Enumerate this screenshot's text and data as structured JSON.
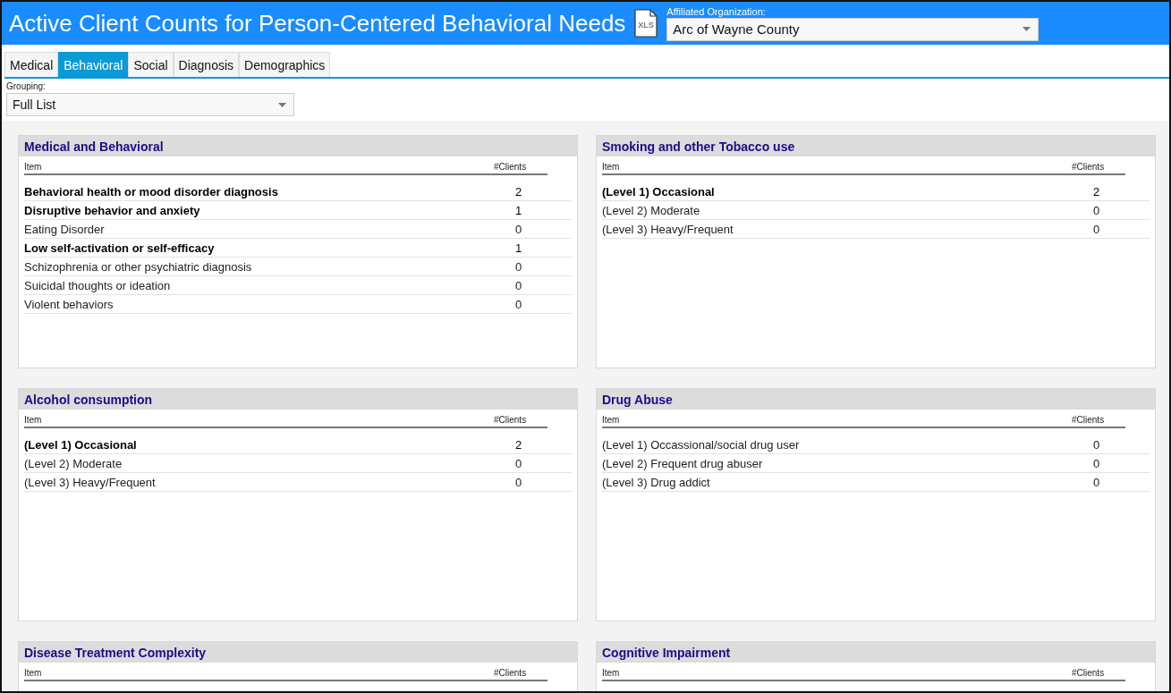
{
  "header": {
    "title": "Active Client Counts for Person-Centered Behavioral Needs",
    "export_icon_text": "XLS",
    "organization": {
      "label": "Affiliated Organization:",
      "value": "Arc of Wayne County"
    }
  },
  "tabs": [
    {
      "label": "Medical",
      "selected": false
    },
    {
      "label": "Behavioral",
      "selected": true
    },
    {
      "label": "Social",
      "selected": false
    },
    {
      "label": "Diagnosis",
      "selected": false
    },
    {
      "label": "Demographics",
      "selected": false
    }
  ],
  "grouping": {
    "label": "Grouping:",
    "value": "Full List"
  },
  "panels": [
    {
      "title": "Medical and Behavioral",
      "columns": [
        "Item",
        "#Clients"
      ],
      "rows": [
        {
          "item": "Behavioral health or mood disorder diagnosis",
          "clients": "2",
          "emphasized": true
        },
        {
          "item": "Disruptive behavior and anxiety",
          "clients": "1",
          "emphasized": true
        },
        {
          "item": "Eating Disorder",
          "clients": "0",
          "emphasized": false
        },
        {
          "item": "Low self-activation or self-efficacy",
          "clients": "1",
          "emphasized": true
        },
        {
          "item": "Schizophrenia or other psychiatric diagnosis",
          "clients": "0",
          "emphasized": false
        },
        {
          "item": "Suicidal thoughts or ideation",
          "clients": "0",
          "emphasized": false
        },
        {
          "item": "Violent behaviors",
          "clients": "0",
          "emphasized": false
        }
      ]
    },
    {
      "title": "Smoking and other Tobacco use",
      "columns": [
        "Item",
        "#Clients"
      ],
      "rows": [
        {
          "item": "(Level 1) Occasional",
          "clients": "2",
          "emphasized": true
        },
        {
          "item": "(Level 2) Moderate",
          "clients": "0",
          "emphasized": false
        },
        {
          "item": "(Level 3) Heavy/Frequent",
          "clients": "0",
          "emphasized": false
        }
      ]
    },
    {
      "title": "Alcohol consumption",
      "columns": [
        "Item",
        "#Clients"
      ],
      "rows": [
        {
          "item": "(Level 1) Occasional",
          "clients": "2",
          "emphasized": true
        },
        {
          "item": "(Level 2) Moderate",
          "clients": "0",
          "emphasized": false
        },
        {
          "item": "(Level 3) Heavy/Frequent",
          "clients": "0",
          "emphasized": false
        }
      ]
    },
    {
      "title": "Drug Abuse",
      "columns": [
        "Item",
        "#Clients"
      ],
      "rows": [
        {
          "item": "(Level 1) Occassional/social drug user",
          "clients": "0",
          "emphasized": false
        },
        {
          "item": "(Level 2) Frequent drug abuser",
          "clients": "0",
          "emphasized": false
        },
        {
          "item": "(Level 3) Drug addict",
          "clients": "0",
          "emphasized": false
        }
      ]
    },
    {
      "title": "Disease Treatment Complexity",
      "columns": [
        "Item",
        "#Clients"
      ]
    },
    {
      "title": "Cognitive Impairment",
      "columns": [
        "Item",
        "#Clients"
      ]
    }
  ]
}
